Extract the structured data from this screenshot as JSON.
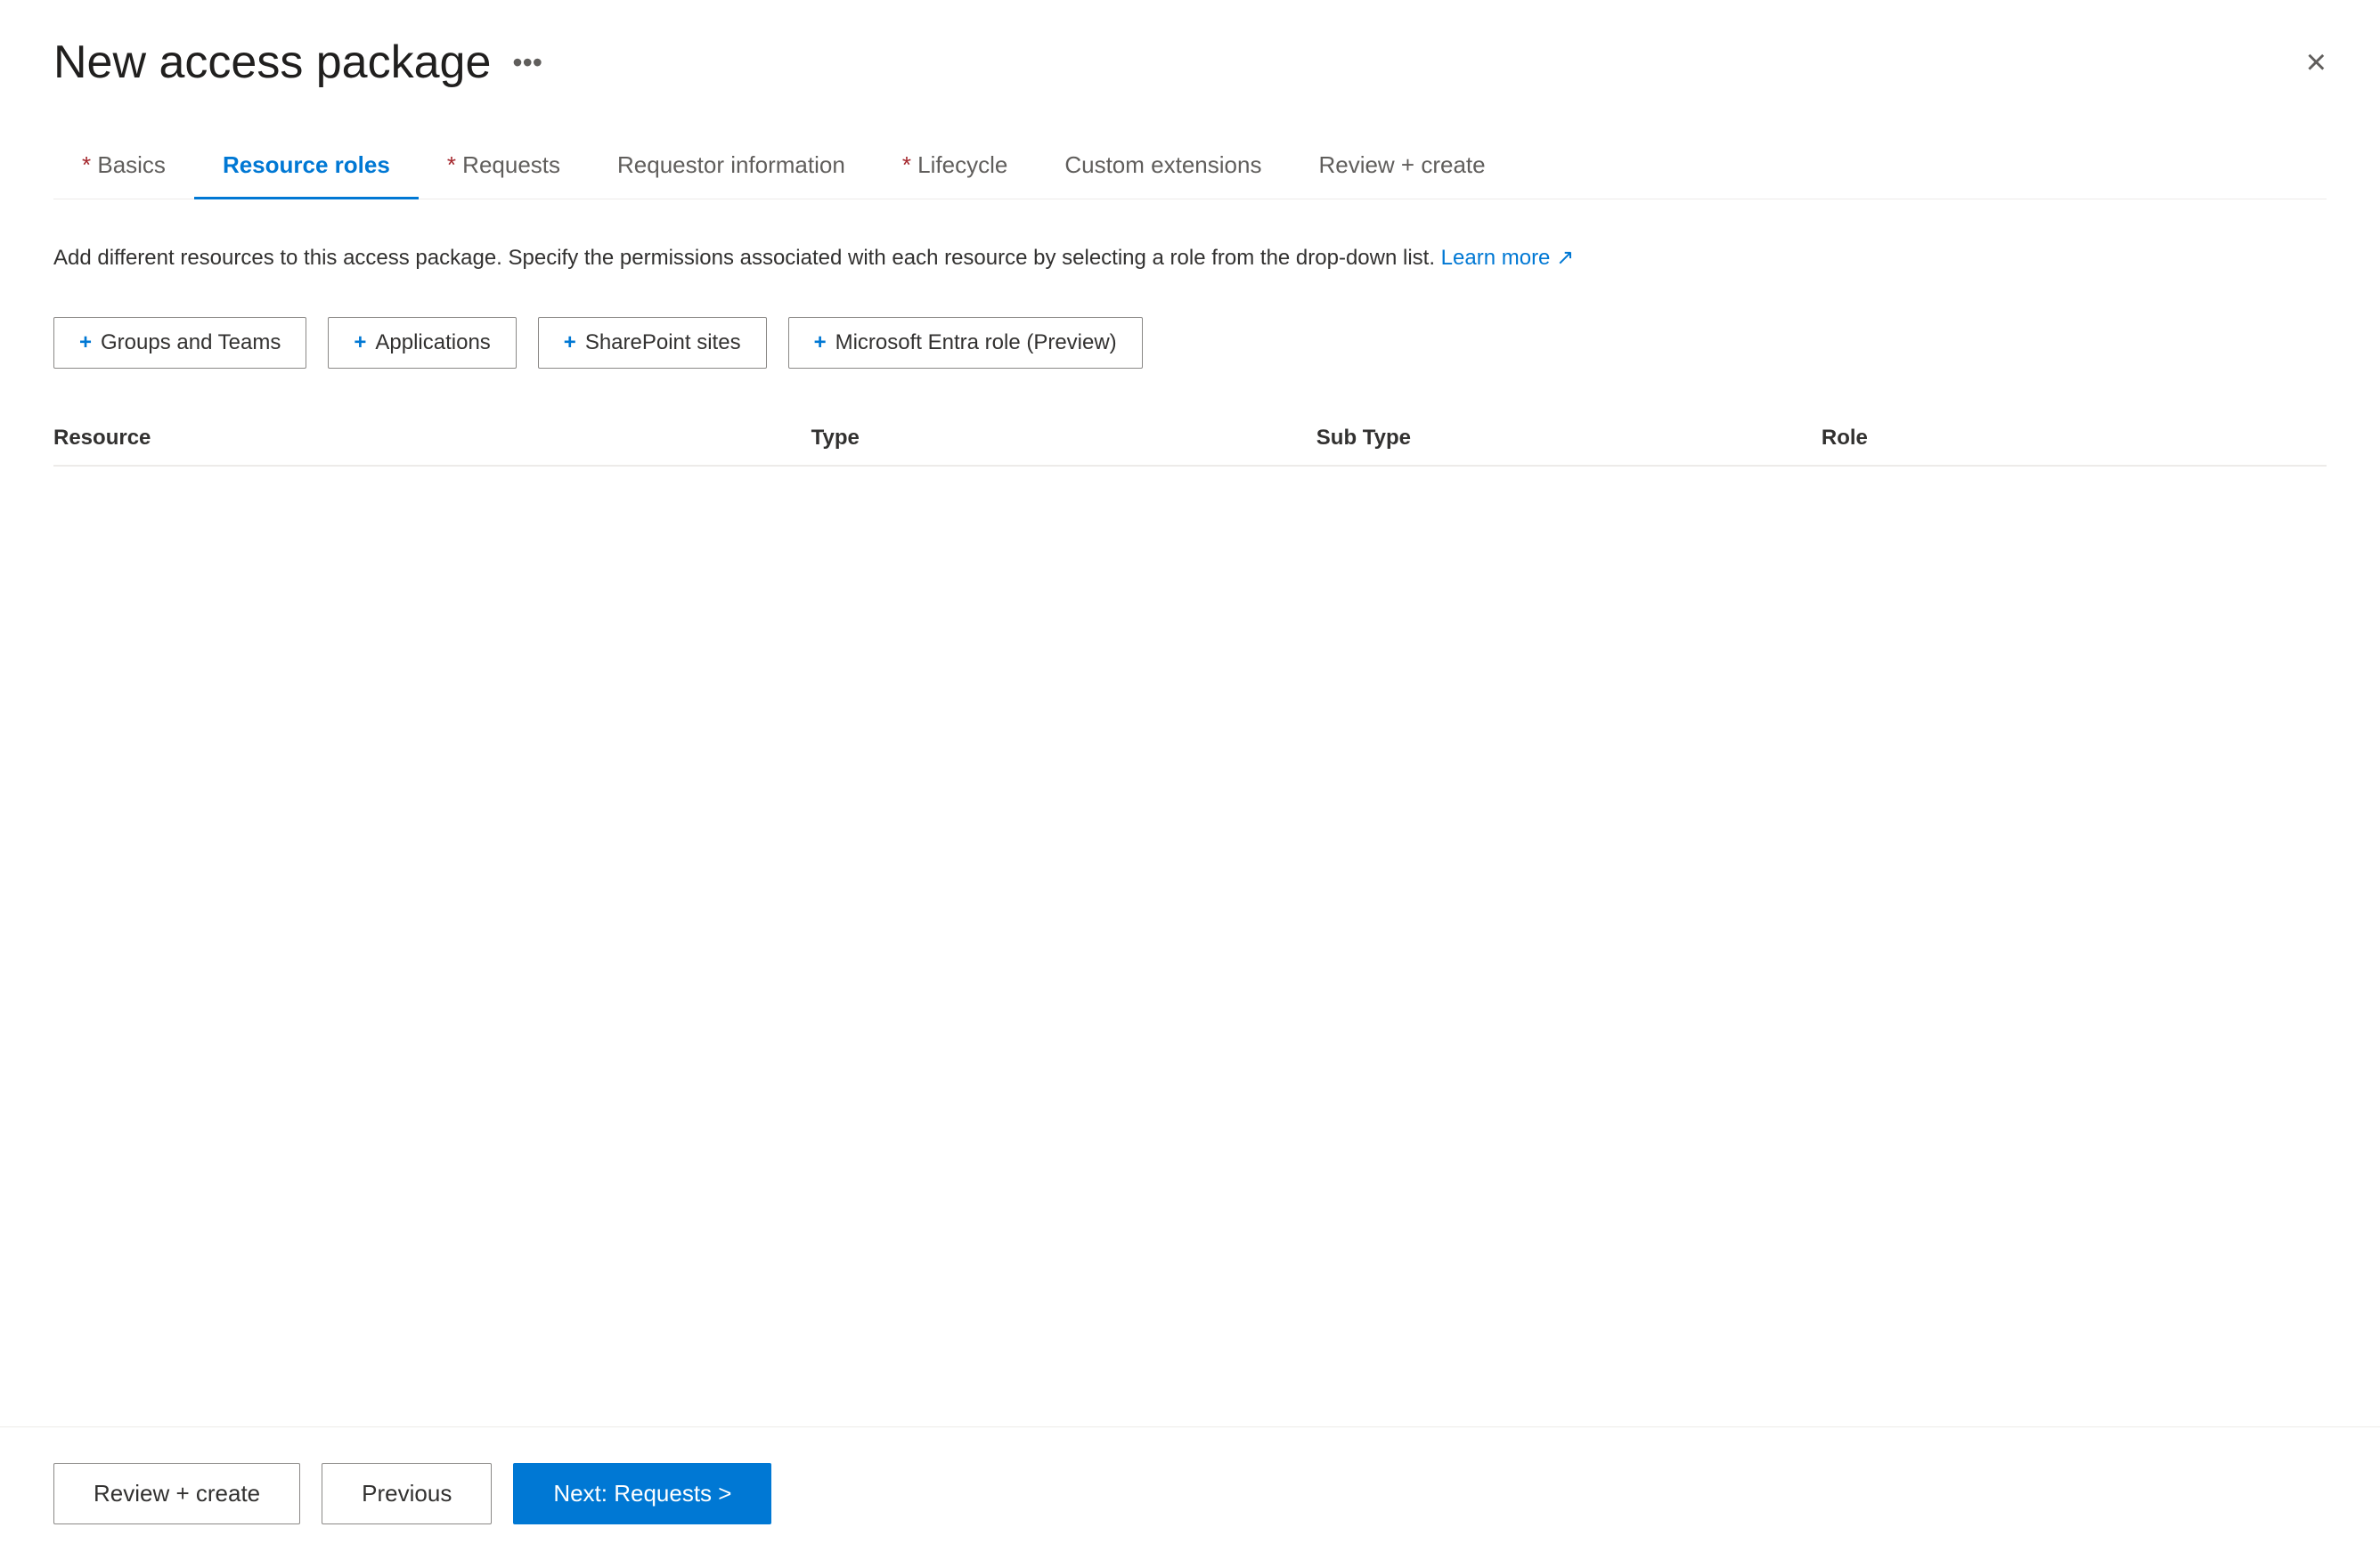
{
  "header": {
    "title": "New access package",
    "more_icon": "•••",
    "close_label": "×"
  },
  "tabs": [
    {
      "id": "basics",
      "label": "Basics",
      "required": true,
      "active": false
    },
    {
      "id": "resource-roles",
      "label": "Resource roles",
      "required": false,
      "active": true
    },
    {
      "id": "requests",
      "label": "Requests",
      "required": true,
      "active": false
    },
    {
      "id": "requestor-info",
      "label": "Requestor information",
      "required": false,
      "active": false
    },
    {
      "id": "lifecycle",
      "label": "Lifecycle",
      "required": true,
      "active": false
    },
    {
      "id": "custom-extensions",
      "label": "Custom extensions",
      "required": false,
      "active": false
    },
    {
      "id": "review-create",
      "label": "Review + create",
      "required": false,
      "active": false
    }
  ],
  "description": {
    "text": "Add different resources to this access package. Specify the permissions associated with each resource by selecting a role from the drop-down list.",
    "link_text": "Learn more",
    "link_icon": "↗"
  },
  "action_buttons": [
    {
      "id": "groups-teams",
      "label": "Groups and Teams"
    },
    {
      "id": "applications",
      "label": "Applications"
    },
    {
      "id": "sharepoint-sites",
      "label": "SharePoint sites"
    },
    {
      "id": "microsoft-entra-role",
      "label": "Microsoft Entra role (Preview)"
    }
  ],
  "table": {
    "columns": [
      {
        "id": "resource",
        "label": "Resource"
      },
      {
        "id": "type",
        "label": "Type"
      },
      {
        "id": "sub-type",
        "label": "Sub Type"
      },
      {
        "id": "role",
        "label": "Role"
      }
    ],
    "rows": []
  },
  "footer": {
    "review_create_label": "Review + create",
    "previous_label": "Previous",
    "next_label": "Next: Requests >"
  }
}
